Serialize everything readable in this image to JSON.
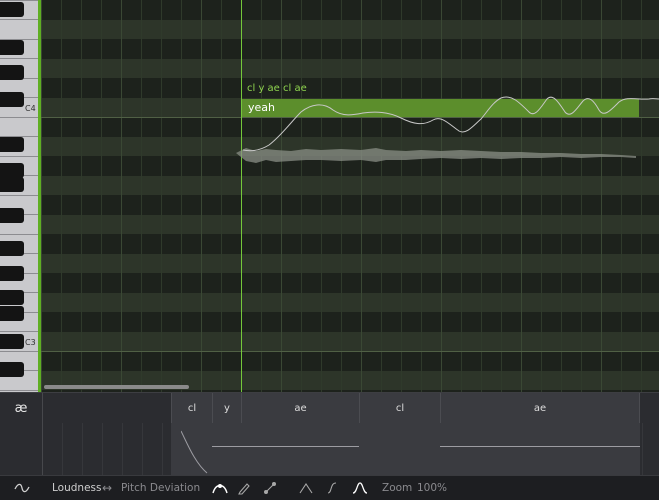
{
  "piano": {
    "labels": [
      "C4",
      "C3"
    ]
  },
  "note": {
    "phonemes": "cl y ae cl ae",
    "lyric": "yeah"
  },
  "phoneme_lane": {
    "icon": "æ",
    "cells": [
      "cl",
      "y",
      "ae",
      "cl",
      "ae"
    ]
  },
  "toolbar": {
    "curve_icon": "curve-wave-icon",
    "param_primary": "Loudness",
    "swap_symbol": "↔",
    "param_secondary": "Pitch Deviation",
    "zoom_label": "Zoom",
    "zoom_value": "100%"
  },
  "colors": {
    "accent": "#74c83a",
    "note": "#5c8e2c",
    "phoneme_text": "#8fd44f"
  }
}
